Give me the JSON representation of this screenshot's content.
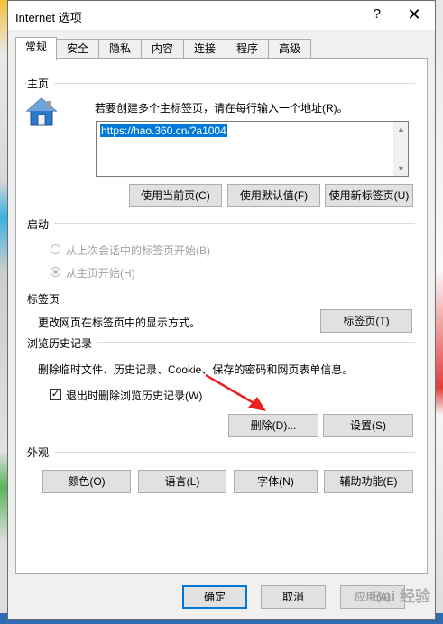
{
  "window": {
    "title": "Internet 选项",
    "help": "?",
    "close": "✕"
  },
  "tabs": [
    {
      "label": "常规",
      "active": true
    },
    {
      "label": "安全"
    },
    {
      "label": "隐私"
    },
    {
      "label": "内容"
    },
    {
      "label": "连接"
    },
    {
      "label": "程序"
    },
    {
      "label": "高级"
    }
  ],
  "home": {
    "section": "主页",
    "instruction": "若要创建多个主标签页，请在每行输入一个地址(R)。",
    "url": "https://hao.360.cn/?a1004",
    "buttons": [
      "使用当前页(C)",
      "使用默认值(F)",
      "使用新标签页(U)"
    ]
  },
  "startup": {
    "section": "启动",
    "options": [
      {
        "label": "从上次会话中的标签页开始(B)",
        "selected": false
      },
      {
        "label": "从主页开始(H)",
        "selected": true
      }
    ]
  },
  "tabs_section": {
    "section": "标签页",
    "description": "更改网页在标签页中的显示方式。",
    "button": "标签页(T)"
  },
  "history": {
    "section": "浏览历史记录",
    "description": "删除临时文件、历史记录、Cookie、保存的密码和网页表单信息。",
    "checkbox_label": "退出时删除浏览历史记录(W)",
    "checkbox_checked": true,
    "delete_button": "删除(D)...",
    "settings_button": "设置(S)"
  },
  "appearance": {
    "section": "外观",
    "buttons": [
      "颜色(O)",
      "语言(L)",
      "字体(N)",
      "辅助功能(E)"
    ]
  },
  "footer": {
    "ok": "确定",
    "cancel": "取消",
    "apply": "应用(A)"
  },
  "watermark": "Bai 经验",
  "colors": {
    "accent": "#0078d7",
    "arrow": "#e8201f"
  },
  "icons": {
    "home": "house-icon",
    "close": "close-icon",
    "help": "help-icon",
    "arrow": "red-arrow-annotation"
  }
}
